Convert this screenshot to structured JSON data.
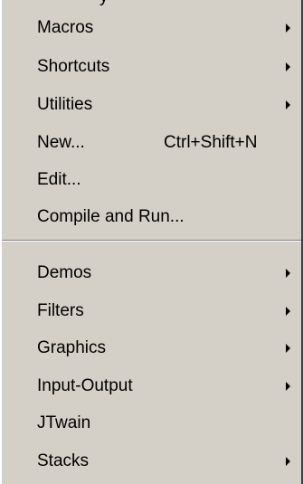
{
  "top_fragment": "y",
  "menu": {
    "group1": [
      {
        "label": "Macros",
        "submenu": true
      },
      {
        "label": "Shortcuts",
        "submenu": true
      },
      {
        "label": "Utilities",
        "submenu": true
      },
      {
        "label": "New...",
        "shortcut": "Ctrl+Shift+N",
        "submenu": false
      },
      {
        "label": "Edit...",
        "submenu": false
      },
      {
        "label": "Compile and Run...",
        "submenu": false
      }
    ],
    "group2": [
      {
        "label": "Demos",
        "submenu": true
      },
      {
        "label": "Filters",
        "submenu": true
      },
      {
        "label": "Graphics",
        "submenu": true
      },
      {
        "label": "Input-Output",
        "submenu": true
      },
      {
        "label": "JTwain",
        "submenu": false
      },
      {
        "label": "Stacks",
        "submenu": true
      }
    ]
  },
  "icons": {
    "submenu_arrow": "submenu-arrow-icon"
  },
  "colors": {
    "menu_background": "#d4d0c8",
    "text": "#000000",
    "separator_dark": "#808080",
    "separator_light": "#ffffff"
  }
}
